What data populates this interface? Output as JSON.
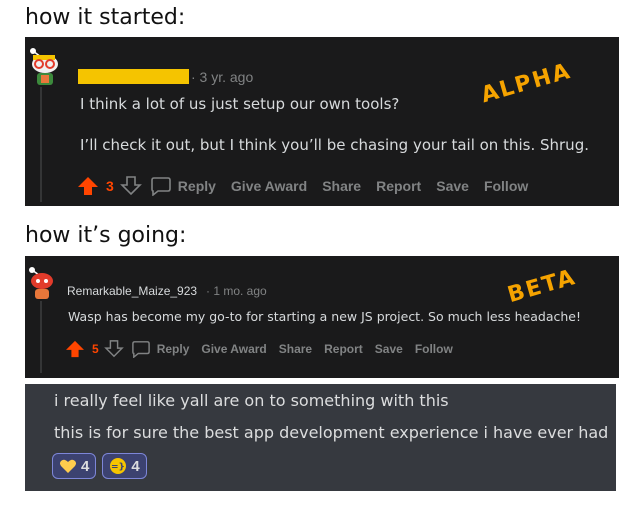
{
  "headings": {
    "first": "how it started:",
    "second": "how it’s going:"
  },
  "alpha": {
    "timestamp": "· 3 yr. ago",
    "line1": "I think a lot of us just setup our own tools?",
    "line2": "I’ll check it out, but I think you’ll be chasing your tail on this. Shrug.",
    "tag": "ALPHA",
    "votes": "3",
    "actions": {
      "reply": "Reply",
      "award": "Give Award",
      "share": "Share",
      "report": "Report",
      "save": "Save",
      "follow": "Follow"
    }
  },
  "beta": {
    "username": "Remarkable_Maize_923",
    "timestamp": "· 1 mo. ago",
    "line1": "Wasp has become my go-to for starting a new JS project. So much less headache!",
    "tag": "BETA",
    "votes": "5",
    "actions": {
      "reply": "Reply",
      "award": "Give Award",
      "share": "Share",
      "report": "Report",
      "save": "Save",
      "follow": "Follow"
    }
  },
  "discord": {
    "line1": "i really feel like yall are on to something with this",
    "line2": "this is for sure the best app development experience i have ever had",
    "reactions": [
      {
        "emoji": "yellow-heart",
        "count": "4"
      },
      {
        "emoji": "custom-emoji",
        "count": "4"
      }
    ]
  },
  "colors": {
    "upvote": "#ff4500",
    "tag": "#f5a300",
    "redaction": "#f5c400",
    "reddit_bg": "#1a1a1b",
    "discord_bg": "#36393f"
  }
}
